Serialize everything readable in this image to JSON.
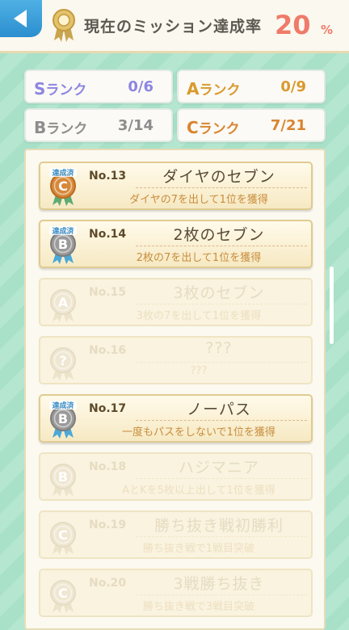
{
  "header": {
    "title": "現在のミッション達成率",
    "rate_value": "20",
    "rate_unit": "%"
  },
  "ranks": [
    {
      "letter": "S",
      "label": "ランク",
      "count": "0/6",
      "color": "#8d86e0"
    },
    {
      "letter": "A",
      "label": "ランク",
      "count": "0/9",
      "color": "#d99a2e"
    },
    {
      "letter": "B",
      "label": "ランク",
      "count": "3/14",
      "color": "#8d8d8d"
    },
    {
      "letter": "C",
      "label": "ランク",
      "count": "7/21",
      "color": "#d98531"
    }
  ],
  "missions": [
    {
      "no": "No.13",
      "title": "ダイヤのセブン",
      "desc": "ダイヤの7を出して1位を獲得",
      "rank": "C",
      "achieved": true,
      "badge": "達成済"
    },
    {
      "no": "No.14",
      "title": "2枚のセブン",
      "desc": "2枚の7を出して1位を獲得",
      "rank": "B",
      "achieved": true,
      "badge": "達成済"
    },
    {
      "no": "No.15",
      "title": "3枚のセブン",
      "desc": "3枚の7を出して1位を獲得",
      "rank": "A",
      "achieved": false
    },
    {
      "no": "No.16",
      "title": "???",
      "desc": "???",
      "rank": "?",
      "achieved": false
    },
    {
      "no": "No.17",
      "title": "ノーパス",
      "desc": "一度もパスをしないで1位を獲得",
      "rank": "B",
      "achieved": true,
      "badge": "達成済"
    },
    {
      "no": "No.18",
      "title": "ハジマニア",
      "desc": "AとKを5枚以上出して1位を獲得",
      "rank": "B",
      "achieved": false
    },
    {
      "no": "No.19",
      "title": "勝ち抜き戦初勝利",
      "desc": "勝ち抜き戦で1戦目突破",
      "rank": "C",
      "achieved": false
    },
    {
      "no": "No.20",
      "title": "3戦勝ち抜き",
      "desc": "勝ち抜き戦で3戦目突破",
      "rank": "C",
      "achieved": false
    }
  ],
  "icons": {
    "back": "back-arrow-icon",
    "header_medal": "medal-icon",
    "rank_emblem": "rank-medal-icon"
  },
  "colors": {
    "accent": "#ef7b6a",
    "back_button": "#3fa3dd",
    "medal_bronze": "#d7893a",
    "medal_silver": "#9a9a9a",
    "ribbon_blue": "#4aa9d8",
    "ribbon_green": "#5eaa73"
  }
}
